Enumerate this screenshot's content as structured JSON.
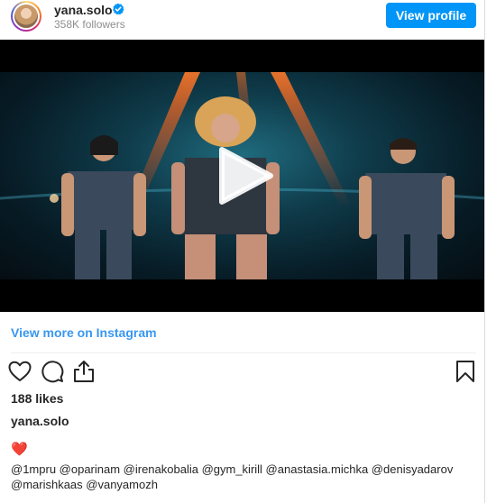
{
  "header": {
    "username": "yana.solo",
    "followers": "358K followers",
    "view_profile_label": "View profile",
    "verified_icon": "verified-badge-icon",
    "accent": "#0095f6"
  },
  "media": {
    "type": "video",
    "play_icon": "play-icon"
  },
  "view_more_label": "View more on Instagram",
  "actions": {
    "like_icon": "heart-outline-icon",
    "comment_icon": "comment-icon",
    "share_icon": "share-icon",
    "save_icon": "bookmark-icon"
  },
  "likes": "188 likes",
  "owner": "yana.solo",
  "caption": {
    "emoji": "❤️",
    "mentions": "@1mpru @oparinam @irenakobalia @gym_kirill @anastasia.michka @denisyadarov @marishkaas @vanyamozh"
  }
}
